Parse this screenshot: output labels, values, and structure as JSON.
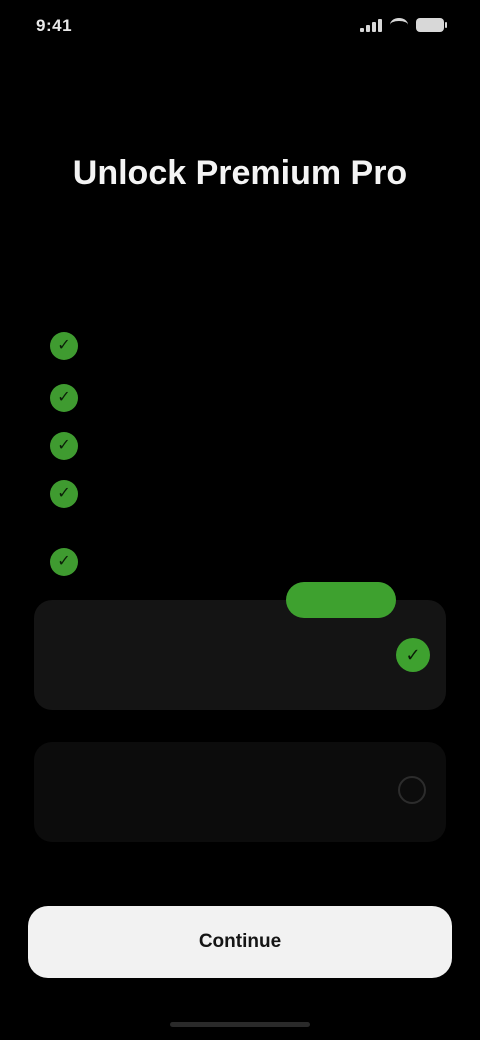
{
  "status_bar": {
    "time": "9:41"
  },
  "paywall": {
    "title": "Unlock Premium Pro",
    "subtitle": "",
    "benefits": [],
    "featured_plan": {
      "badge": "",
      "label": "",
      "price": "",
      "note": ""
    },
    "other_plan": {
      "label": "",
      "price": ""
    },
    "restore_label": "",
    "cta_label": "Continue"
  },
  "colors": {
    "background": "#000000",
    "accent_green": "#3ea12f",
    "card": "#141414",
    "cta_background": "#f2f2f2"
  }
}
